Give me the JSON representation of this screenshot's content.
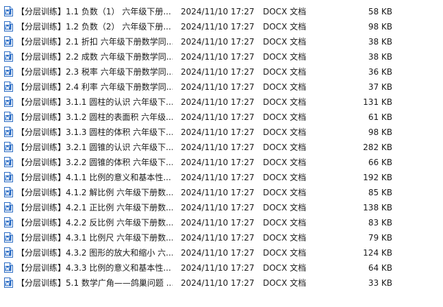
{
  "icon": "word-document-icon",
  "colors": {
    "icon_blue": "#2b6cc4",
    "text": "#1a1a1a",
    "background": "#ffffff"
  },
  "files": [
    {
      "name": "【分层训练】1.1 负数（1） 六年级下册...",
      "modified": "2024/11/10 17:27",
      "type": "DOCX 文档",
      "size": "58 KB"
    },
    {
      "name": "【分层训练】1.2 负数（2） 六年级下册...",
      "modified": "2024/11/10 17:27",
      "type": "DOCX 文档",
      "size": "98 KB"
    },
    {
      "name": "【分层训练】2.1 折扣 六年级下册数学同...",
      "modified": "2024/11/10 17:27",
      "type": "DOCX 文档",
      "size": "38 KB"
    },
    {
      "name": "【分层训练】2.2 成数 六年级下册数学同...",
      "modified": "2024/11/10 17:27",
      "type": "DOCX 文档",
      "size": "38 KB"
    },
    {
      "name": "【分层训练】2.3 税率 六年级下册数学同...",
      "modified": "2024/11/10 17:27",
      "type": "DOCX 文档",
      "size": "36 KB"
    },
    {
      "name": "【分层训练】2.4 利率 六年级下册数学同...",
      "modified": "2024/11/10 17:27",
      "type": "DOCX 文档",
      "size": "37 KB"
    },
    {
      "name": "【分层训练】3.1.1 圆柱的认识 六年级下...",
      "modified": "2024/11/10 17:27",
      "type": "DOCX 文档",
      "size": "131 KB"
    },
    {
      "name": "【分层训练】3.1.2 圆柱的表面积 六年级...",
      "modified": "2024/11/10 17:27",
      "type": "DOCX 文档",
      "size": "61 KB"
    },
    {
      "name": "【分层训练】3.1.3 圆柱的体积 六年级下...",
      "modified": "2024/11/10 17:27",
      "type": "DOCX 文档",
      "size": "98 KB"
    },
    {
      "name": "【分层训练】3.2.1 圆锥的认识 六年级下...",
      "modified": "2024/11/10 17:27",
      "type": "DOCX 文档",
      "size": "282 KB"
    },
    {
      "name": "【分层训练】3.2.2 圆锥的体积 六年级下...",
      "modified": "2024/11/10 17:27",
      "type": "DOCX 文档",
      "size": "66 KB"
    },
    {
      "name": "【分层训练】4.1.1 比例的意义和基本性...",
      "modified": "2024/11/10 17:27",
      "type": "DOCX 文档",
      "size": "192 KB"
    },
    {
      "name": "【分层训练】4.1.2 解比例 六年级下册数...",
      "modified": "2024/11/10 17:27",
      "type": "DOCX 文档",
      "size": "85 KB"
    },
    {
      "name": "【分层训练】4.2.1 正比例 六年级下册数...",
      "modified": "2024/11/10 17:27",
      "type": "DOCX 文档",
      "size": "138 KB"
    },
    {
      "name": "【分层训练】4.2.2 反比例 六年级下册数...",
      "modified": "2024/11/10 17:27",
      "type": "DOCX 文档",
      "size": "83 KB"
    },
    {
      "name": "【分层训练】4.3.1 比例尺 六年级下册数...",
      "modified": "2024/11/10 17:27",
      "type": "DOCX 文档",
      "size": "79 KB"
    },
    {
      "name": "【分层训练】4.3.2 图形的放大和缩小 六...",
      "modified": "2024/11/10 17:27",
      "type": "DOCX 文档",
      "size": "124 KB"
    },
    {
      "name": "【分层训练】4.3.3 比例的意义和基本性...",
      "modified": "2024/11/10 17:27",
      "type": "DOCX 文档",
      "size": "64 KB"
    },
    {
      "name": "【分层训练】5.1 数学广角——鸽巢问题 ...",
      "modified": "2024/11/10 17:27",
      "type": "DOCX 文档",
      "size": "33 KB"
    }
  ]
}
